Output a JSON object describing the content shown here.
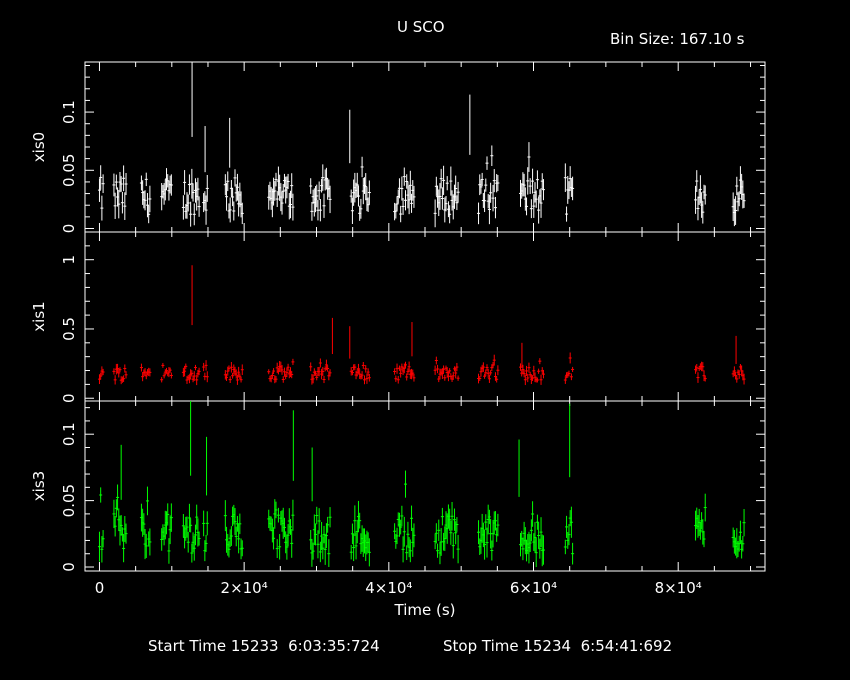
{
  "title": "U SCO",
  "bin_size": "Bin Size: 167.10 s",
  "footer": {
    "start": "Start Time 15233  6:03:35:724",
    "stop": "Stop Time 15234  6:54:41:692"
  },
  "colors": {
    "background": "#000000",
    "axes": "#ffffff",
    "xis0": "#ffffff",
    "xis1": "#ff0000",
    "xis3": "#00ff00"
  },
  "chart_data": {
    "type": "scatter",
    "title": "U SCO",
    "subtitle": "Bin Size: 167.10 s",
    "xlabel": "Time (s)",
    "xlim": [
      -2000,
      92000
    ],
    "x_ticks": [
      0,
      20000,
      40000,
      60000,
      80000
    ],
    "x_tick_labels": [
      "0",
      "2×10⁴",
      "4×10⁴",
      "6×10⁴",
      "8×10⁴"
    ],
    "observation_segments": [
      [
        0,
        600
      ],
      [
        2000,
        3800
      ],
      [
        5800,
        7000
      ],
      [
        8600,
        10000
      ],
      [
        11600,
        13800
      ],
      [
        14400,
        15000
      ],
      [
        17400,
        19800
      ],
      [
        23400,
        26800
      ],
      [
        29200,
        32000
      ],
      [
        34800,
        37400
      ],
      [
        40800,
        43600
      ],
      [
        46400,
        49600
      ],
      [
        52400,
        55200
      ],
      [
        58200,
        61400
      ],
      [
        64400,
        65500
      ],
      [
        82400,
        83800
      ],
      [
        87600,
        89200
      ]
    ],
    "panels": [
      {
        "name": "xis0",
        "ylabel": "xis0",
        "ylim": [
          -0.003,
          0.143
        ],
        "y_ticks": [
          0,
          0.05,
          0.1
        ],
        "y_tick_labels": [
          "0",
          "0.05",
          "0.1"
        ],
        "typical_rate": 0.028,
        "scatter": 0.016,
        "spikes": [
          [
            12800,
            0.143
          ],
          [
            51200,
            0.115
          ],
          [
            34600,
            0.102
          ],
          [
            18000,
            0.095
          ],
          [
            14600,
            0.088
          ]
        ]
      },
      {
        "name": "xis1",
        "ylabel": "xis1",
        "ylim": [
          -0.02,
          1.2
        ],
        "y_ticks": [
          0,
          0.5,
          1
        ],
        "y_tick_labels": [
          "0",
          "0.5",
          "1"
        ],
        "typical_rate": 0.18,
        "scatter": 0.05,
        "spikes": [
          [
            12800,
            0.96
          ],
          [
            32200,
            0.58
          ],
          [
            43200,
            0.55
          ],
          [
            34600,
            0.52
          ],
          [
            58400,
            0.4
          ],
          [
            88000,
            0.45
          ]
        ]
      },
      {
        "name": "xis3",
        "ylabel": "xis3",
        "ylim": [
          -0.003,
          0.125
        ],
        "y_ticks": [
          0,
          0.05,
          0.1
        ],
        "y_tick_labels": [
          "0",
          "0.05",
          "0.1"
        ],
        "typical_rate": 0.025,
        "scatter": 0.015,
        "spikes": [
          [
            12600,
            0.125
          ],
          [
            65000,
            0.123
          ],
          [
            26800,
            0.118
          ],
          [
            14800,
            0.098
          ],
          [
            58000,
            0.096
          ],
          [
            29400,
            0.09
          ],
          [
            3000,
            0.092
          ]
        ]
      }
    ]
  }
}
